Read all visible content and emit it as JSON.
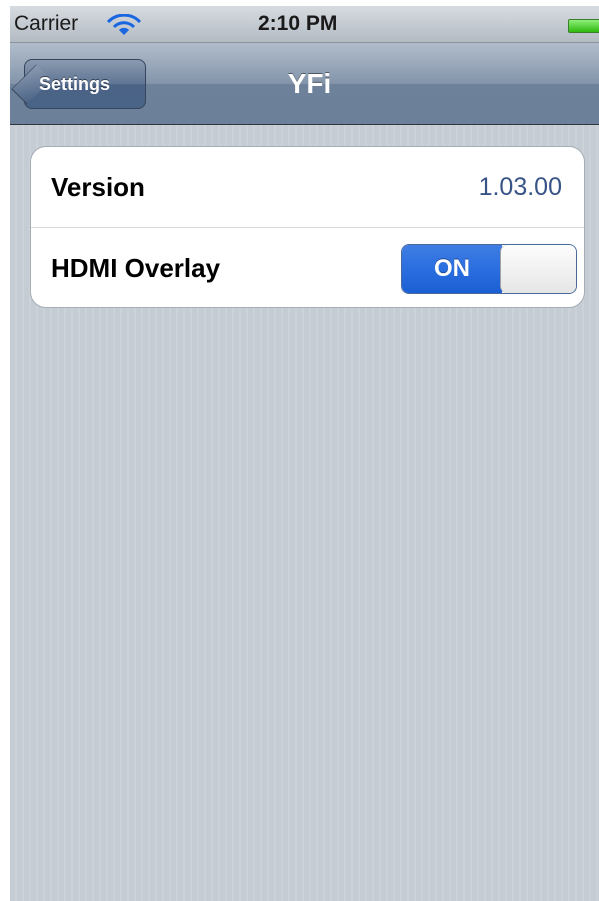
{
  "status_bar": {
    "carrier": "Carrier",
    "time": "2:10 PM",
    "icons": [
      "wifi-icon",
      "battery-icon"
    ]
  },
  "nav_bar": {
    "back_label": "Settings",
    "title": "YFi"
  },
  "settings": {
    "version_label": "Version",
    "version_value": "1.03.00",
    "hdmi_label": "HDMI Overlay",
    "hdmi_toggle_state": "ON"
  },
  "colors": {
    "nav_bar": "#6d819a",
    "toggle_on": "#2a6ee0",
    "value_text": "#385487",
    "background": "#c5ccd4"
  }
}
